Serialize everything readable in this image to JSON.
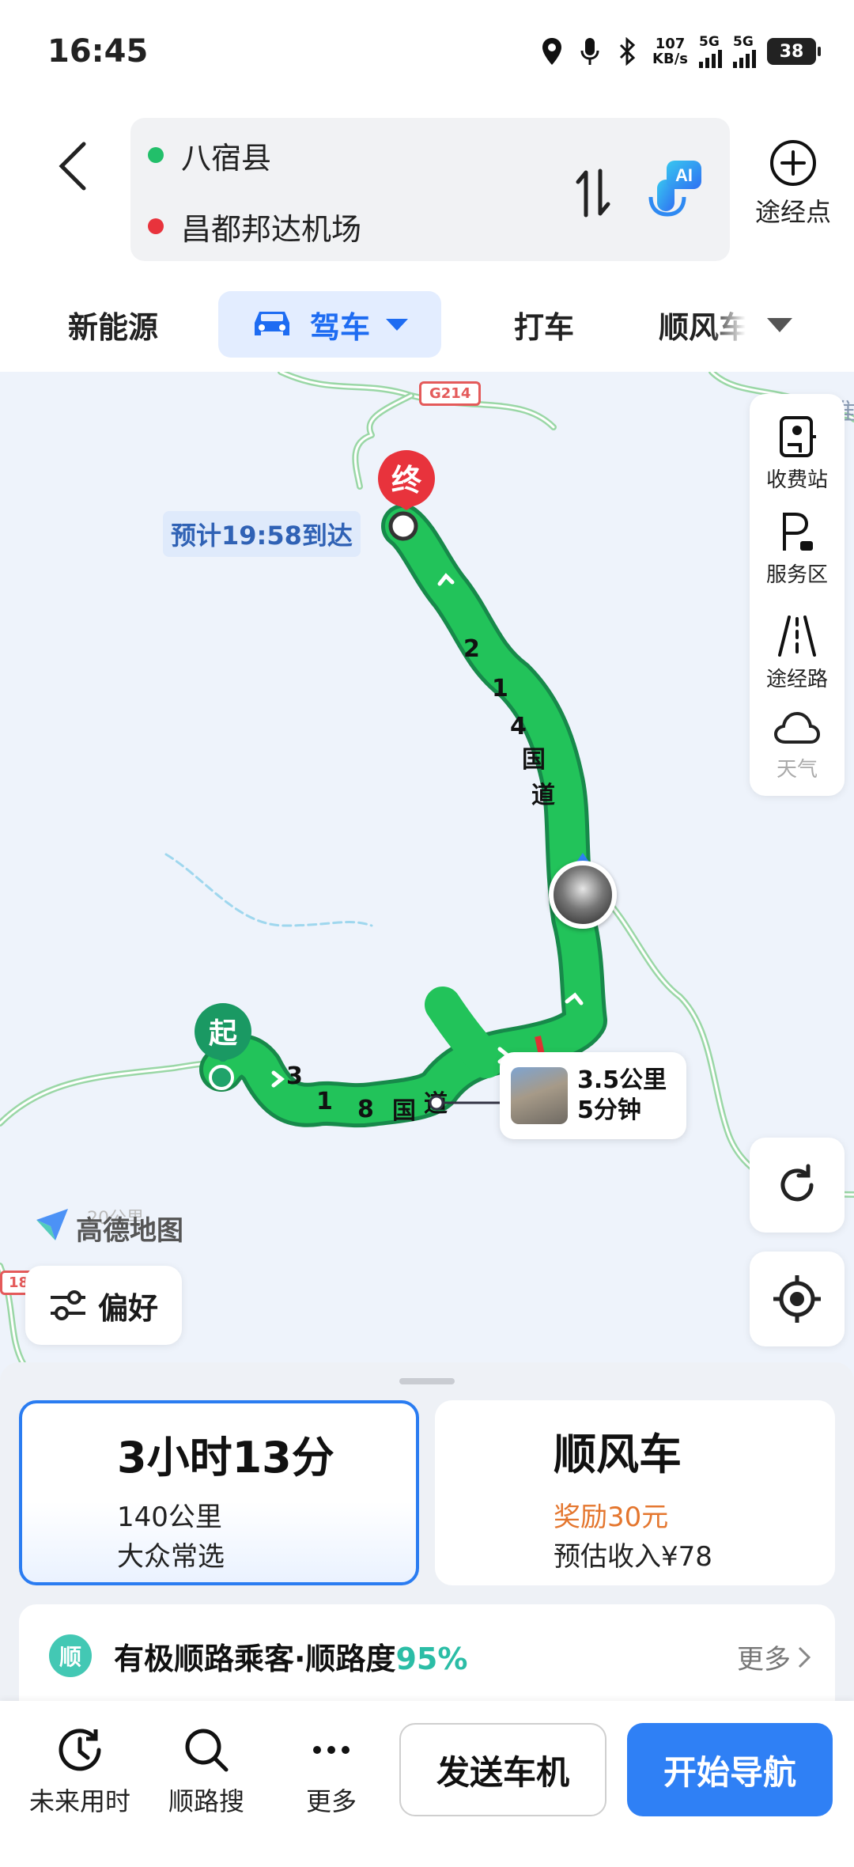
{
  "status_bar": {
    "time": "16:45",
    "net_speed_value": "107",
    "net_speed_unit": "KB/s",
    "sim1": "5G",
    "sim2": "5G",
    "battery": "38",
    "icons": [
      "location-icon",
      "microphone-icon",
      "bluetooth-icon"
    ]
  },
  "route": {
    "origin": "八宿县",
    "destination": "昌都邦达机场",
    "origin_color": "#22bf6a",
    "destination_color": "#e8333c",
    "ai_label": "AI",
    "waypoint_label": "途经点"
  },
  "modes": {
    "items": [
      "新能源",
      "驾车",
      "打车",
      "顺风车"
    ],
    "active": "驾车",
    "accent": "#1e6cf2"
  },
  "map": {
    "eta": "预计19:58到达",
    "end_marker": "终",
    "start_marker": "起",
    "road_chip_top": "G214",
    "road_chip_left": "18",
    "route_road_1": [
      "2",
      "1",
      "4",
      "国",
      "道"
    ],
    "route_road_2": [
      "3",
      "1",
      "8",
      "国",
      "道"
    ],
    "corner_text": "准",
    "brand": "高德地图",
    "scale": "20公里",
    "route_color": "#1fb653",
    "segment": {
      "distance": "3.5公里",
      "time": "5分钟"
    },
    "tools": [
      {
        "label": "收费站",
        "icon": "toll-station-icon"
      },
      {
        "label": "服务区",
        "icon": "service-area-icon"
      },
      {
        "label": "途经路",
        "icon": "road-icon"
      },
      {
        "label": "天气",
        "icon": "cloud-icon"
      }
    ],
    "preference_label": "偏好"
  },
  "sheet": {
    "selected_route": {
      "duration": "3小时13分",
      "distance": "140公里",
      "tag": "大众常选"
    },
    "alt_route": {
      "title": "顺风车",
      "reward": "奖励30元",
      "income": "预估收入¥78"
    },
    "match": {
      "badge": "顺",
      "text": "有极顺路乘客·顺路度",
      "percent": "95%",
      "more": "更多"
    }
  },
  "bottom_bar": {
    "future": "未来用时",
    "search_along": "顺路搜",
    "more": "更多",
    "send_to_car": "发送车机",
    "start_nav": "开始导航"
  }
}
